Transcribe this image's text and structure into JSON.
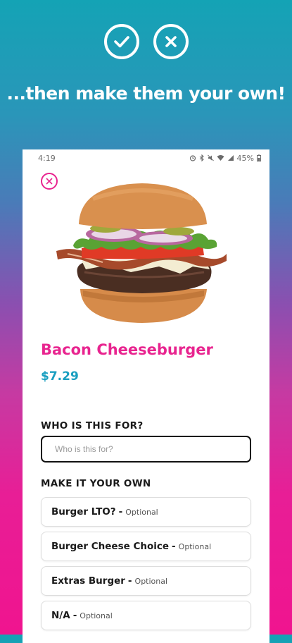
{
  "promo": {
    "headline": "...then make them your own!",
    "icons": [
      "check-icon",
      "x-icon"
    ]
  },
  "statusbar": {
    "time": "4:19",
    "battery": "45%"
  },
  "item": {
    "name": "Bacon Cheeseburger",
    "price": "$7.29"
  },
  "who": {
    "label": "WHO IS THIS FOR?",
    "placeholder": "Who is this for?",
    "value": ""
  },
  "customize": {
    "label": "MAKE IT YOUR OWN",
    "options": [
      {
        "title": "Burger LTO?",
        "sep": "-",
        "note": "Optional"
      },
      {
        "title": "Burger Cheese Choice",
        "sep": "-",
        "note": "Optional"
      },
      {
        "title": "Extras Burger",
        "sep": "-",
        "note": "Optional"
      },
      {
        "title": "N/A",
        "sep": "-",
        "note": "Optional"
      }
    ]
  },
  "colors": {
    "accent": "#e8248f",
    "price": "#1a9fc0",
    "gradient_top": "#14a3b5",
    "gradient_bottom": "#f0148f"
  }
}
